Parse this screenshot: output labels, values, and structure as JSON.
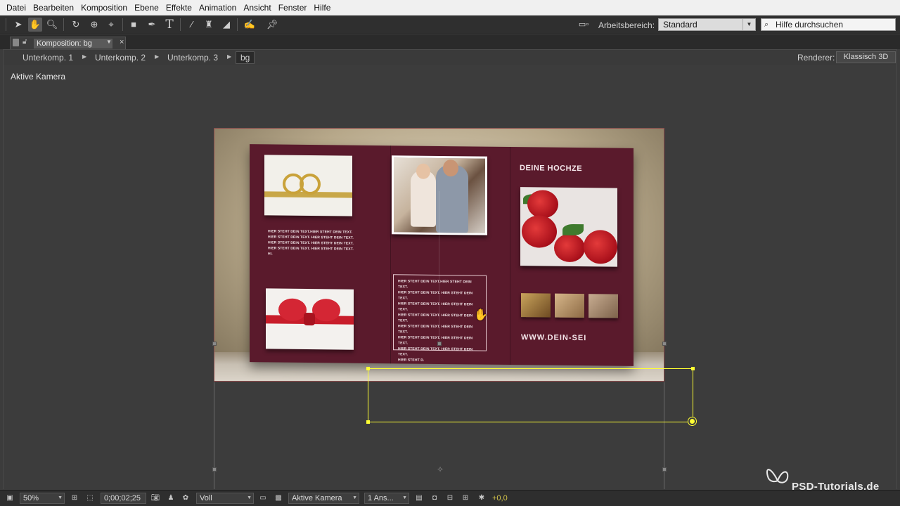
{
  "menu": [
    "Datei",
    "Bearbeiten",
    "Komposition",
    "Ebene",
    "Effekte",
    "Animation",
    "Ansicht",
    "Fenster",
    "Hilfe"
  ],
  "toolbar": {
    "tool_icons": [
      "selection-tool",
      "hand-tool",
      "zoom-tool",
      "rotate-tool",
      "orbit-camera-tool",
      "track-xy-camera-tool",
      "rectangle-tool",
      "pen-tool",
      "text-tool",
      "brush-tool",
      "clone-stamp-tool",
      "eraser-tool",
      "roto-brush-tool",
      "puppet-pin-tool"
    ],
    "active_tool": "hand-tool",
    "workspace_label": "Arbeitsbereich:",
    "workspace_value": "Standard",
    "help_placeholder": "Hilfe durchsuchen"
  },
  "panel": {
    "tab_title": "Komposition: bg",
    "breadcrumbs": [
      "Unterkomp. 1",
      "Unterkomp. 2",
      "Unterkomp. 3",
      "bg"
    ],
    "renderer_label": "Renderer:",
    "renderer_value": "Klassisch 3D"
  },
  "viewer": {
    "camera_label": "Aktive Kamera"
  },
  "composition": {
    "heading": "DEINE HOCHZE",
    "url": "WWW.DEIN-SEI",
    "left_text": "HIER STEHT DEIN TEXT.HIER STEHT DEIN TEXT.\nHIER STEHT DEIN TEXT. HIER STEHT DEIN TEXT.\nHIER STEHT DEIN TEXT. HIER STEHT DEIN TEXT.\nHIER STEHT DEIN TEXT. HIER STEHT DEIN TEXT.\nHI.",
    "box_text": "HIER STEHT DEIN TEXT.HIER STEHT DEIN TEXT.\nHIER STEHT DEIN TEXT. HIER STEHT DEIN TEXT.\nHIER STEHT DEIN TEXT. HIER STEHT DEIN TEXT.\nHIER STEHT DEIN TEXT. HIER STEHT DEIN TEXT.\nHIER STEHT DEIN TEXT. HIER STEHT DEIN TEXT.\nHIER STEHT DEIN TEXT. HIER STEHT DEIN TEXT.\nHIER STEHT DEIN TEXT. HIER STEHT DEIN TEXT.\nHIER STEHT D."
  },
  "statusbar": {
    "zoom": "50%",
    "timecode": "0;00;02;25",
    "resolution": "Voll",
    "view": "Aktive Kamera",
    "layout": "1 Ans...",
    "exposure": "+0,0"
  },
  "watermark": "PSD-Tutorials.de",
  "colors": {
    "accent_yellow": "#ffff33",
    "card_bg": "#5a1a2c",
    "exposure_value": "#d7c64a"
  }
}
